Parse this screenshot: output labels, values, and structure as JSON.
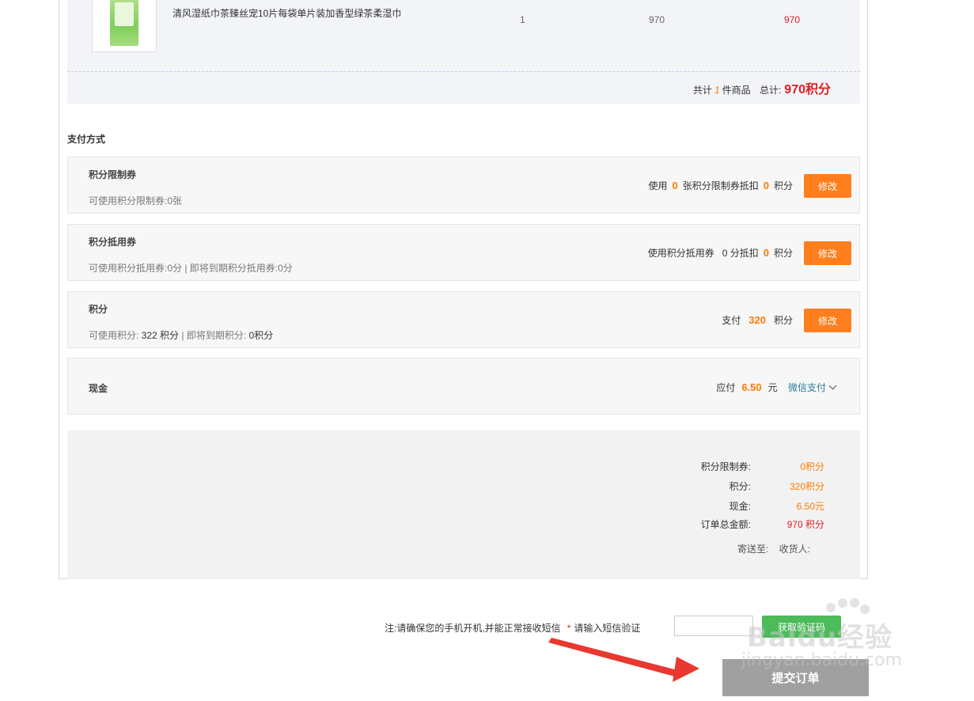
{
  "product": {
    "name": "清风湿纸巾茶臻丝宠10片每袋单片装加香型绿茶柔湿巾",
    "quantity": "1",
    "unit_points": "970",
    "subtotal_points": "970"
  },
  "totals": {
    "prefix": "共计",
    "count": "1",
    "count_suffix": "件商品",
    "total_label": "总计:",
    "total_value": "970积分"
  },
  "payment_section_title": "支付方式",
  "payments": [
    {
      "title": "积分限制券",
      "sub": "可使用积分限制券:0张",
      "right_prefix": "使用",
      "right_v1": "0",
      "right_mid": "张积分限制券抵扣",
      "right_v2": "0",
      "right_suffix": "积分",
      "button": "修改"
    },
    {
      "title": "积分抵用券",
      "sub": "可使用积分抵用券:0分 | 即将到期积分抵用券:0分",
      "right_prefix": "使用积分抵用券",
      "right_mid": "0 分抵扣",
      "right_v2": "0",
      "right_suffix": "积分",
      "button": "修改"
    },
    {
      "title": "积分",
      "sub_prefix": "可使用积分:",
      "sub_value": "322 积分",
      "sub_suffix": "| 即将到期积分:",
      "sub_value2": "0积分",
      "right_prefix": "支付",
      "right_v1": "320",
      "right_suffix": "积分",
      "button": "修改"
    },
    {
      "title": "现金",
      "right_prefix": "应付",
      "right_v1": "6.50",
      "right_suffix": "元",
      "method": "微信支付"
    }
  ],
  "summary": {
    "rows": [
      {
        "label": "积分限制券:",
        "value": "0积分"
      },
      {
        "label": "积分:",
        "value": "320积分"
      },
      {
        "label": "现金:",
        "value": "6.50元"
      },
      {
        "label": "订单总金额:",
        "value": "970 积分"
      }
    ],
    "ship_to": "寄送至:",
    "receiver": "收货人:"
  },
  "sms": {
    "note": "注:请确保您的手机开机,并能正常接收短信",
    "star": "*",
    "prompt": "请输入短信验证",
    "input_value": "",
    "button": "获取验证码"
  },
  "submit_label": "提交订单",
  "watermark": {
    "text": "Baidu经验",
    "url": "jingyan.baidu.com"
  },
  "colors": {
    "accent_orange": "#ff7e1d",
    "price_red": "#e02020",
    "sms_green": "#4cbb5a",
    "arrow_red": "#e8382f"
  }
}
